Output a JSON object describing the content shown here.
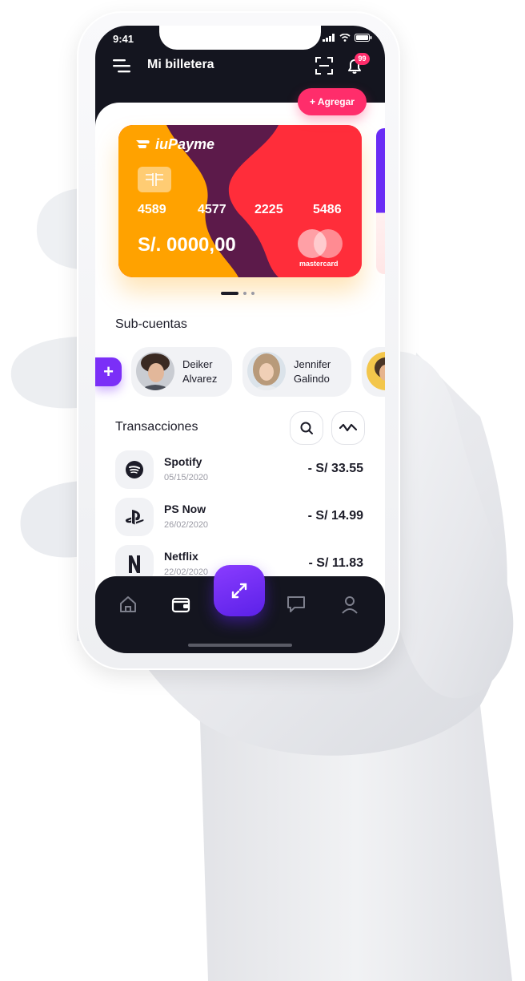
{
  "status_bar": {
    "time": "9:41"
  },
  "header": {
    "title": "Mi billetera",
    "notifications_count": "99"
  },
  "actions": {
    "add_label": "+ Agregar"
  },
  "card": {
    "brand": "iuPayme",
    "number_groups": [
      "4589",
      "4577",
      "2225",
      "5486"
    ],
    "balance": "S/. 0000,00",
    "network": "mastercard"
  },
  "carousel": {
    "pages": 3,
    "active_page": 1
  },
  "subaccounts": {
    "title": "Sub-cuentas",
    "add_symbol": "+",
    "people": [
      {
        "first": "Deiker",
        "last": "Alvarez"
      },
      {
        "first": "Jennifer",
        "last": "Galindo"
      }
    ]
  },
  "transactions": {
    "title": "Transacciones",
    "items": [
      {
        "name": "Spotify",
        "date": "05/15/2020",
        "amount": "- S/ 33.55",
        "icon": "spotify-icon"
      },
      {
        "name": "PS Now",
        "date": "26/02/2020",
        "amount": "- S/ 14.99",
        "icon": "playstation-icon"
      },
      {
        "name": "Netflix",
        "date": "22/02/2020",
        "amount": "- S/ 11.83",
        "icon": "netflix-icon"
      }
    ]
  },
  "bottom_nav": {
    "items": [
      "home-icon",
      "wallet-icon",
      "transfer-icon",
      "chat-icon",
      "profile-icon"
    ],
    "active": "wallet-icon"
  },
  "colors": {
    "dark": "#14151f",
    "accent_pink": "#ff2d6b",
    "accent_purple": "#7b2ff7",
    "card_orange": "#ffa200",
    "card_red": "#ff2d3a",
    "card_plum": "#5c1a4a"
  }
}
